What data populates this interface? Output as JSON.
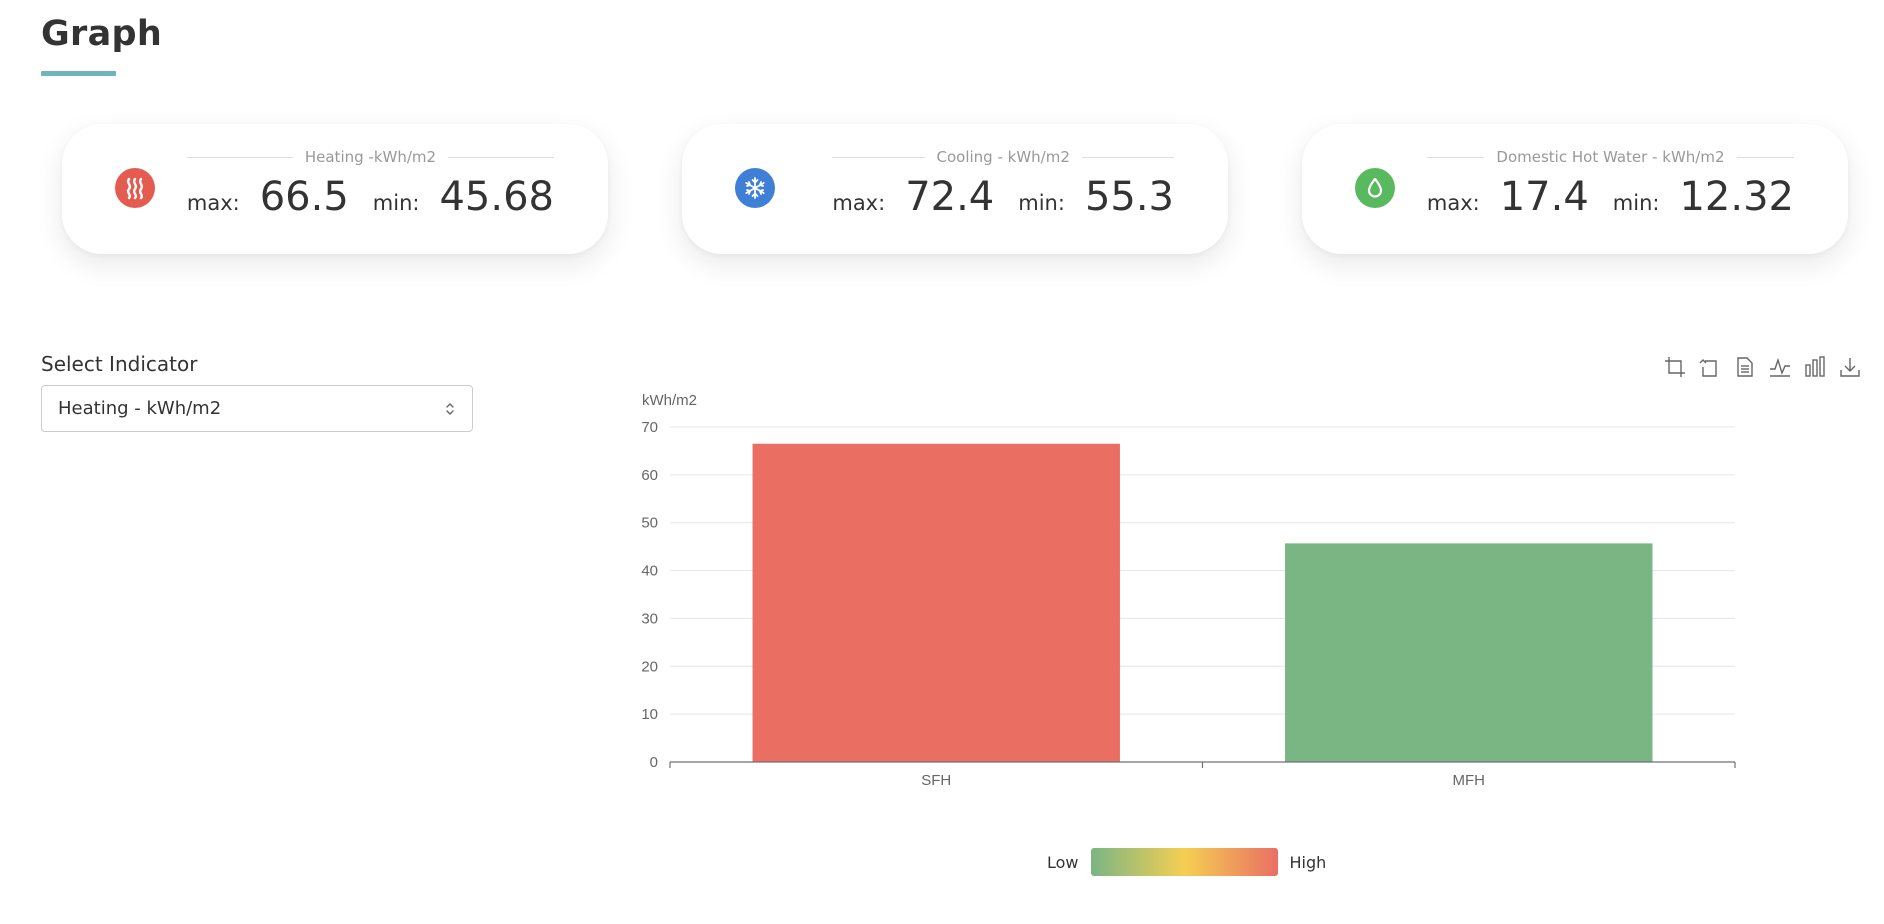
{
  "page": {
    "title": "Graph"
  },
  "cards": [
    {
      "caption": "Heating -kWh/m2",
      "max_label": "max:",
      "max": "66.5",
      "min_label": "min:",
      "min": "45.68",
      "icon": "heating-icon",
      "color": "#e45b50"
    },
    {
      "caption": "Cooling - kWh/m2",
      "max_label": "max:",
      "max": "72.4",
      "min_label": "min:",
      "min": "55.3",
      "icon": "snowflake-icon",
      "color": "#3f7fd6"
    },
    {
      "caption": "Domestic Hot Water - kWh/m2",
      "max_label": "max:",
      "max": "17.4",
      "min_label": "min:",
      "min": "12.32",
      "icon": "water-drop-icon",
      "color": "#58b95f"
    }
  ],
  "select": {
    "label": "Select Indicator",
    "value": "Heating - kWh/m2"
  },
  "toolbox": [
    "zoom-icon",
    "zoom-reset-icon",
    "data-view-icon",
    "line-chart-icon",
    "bar-chart-icon",
    "download-icon"
  ],
  "chart_data": {
    "type": "bar",
    "categories": [
      "SFH",
      "MFH"
    ],
    "values": [
      66.5,
      45.68
    ],
    "bar_colors": [
      "#eb6e63",
      "#7ab584"
    ],
    "ylabel": "kWh/m2",
    "ylim": [
      0,
      70
    ],
    "yticks": [
      0,
      10,
      20,
      30,
      40,
      50,
      60,
      70
    ],
    "grid": true
  },
  "visual_map": {
    "low": "Low",
    "high": "High",
    "colors": [
      "#7ab584",
      "#f5cf52",
      "#ea6f64"
    ]
  }
}
